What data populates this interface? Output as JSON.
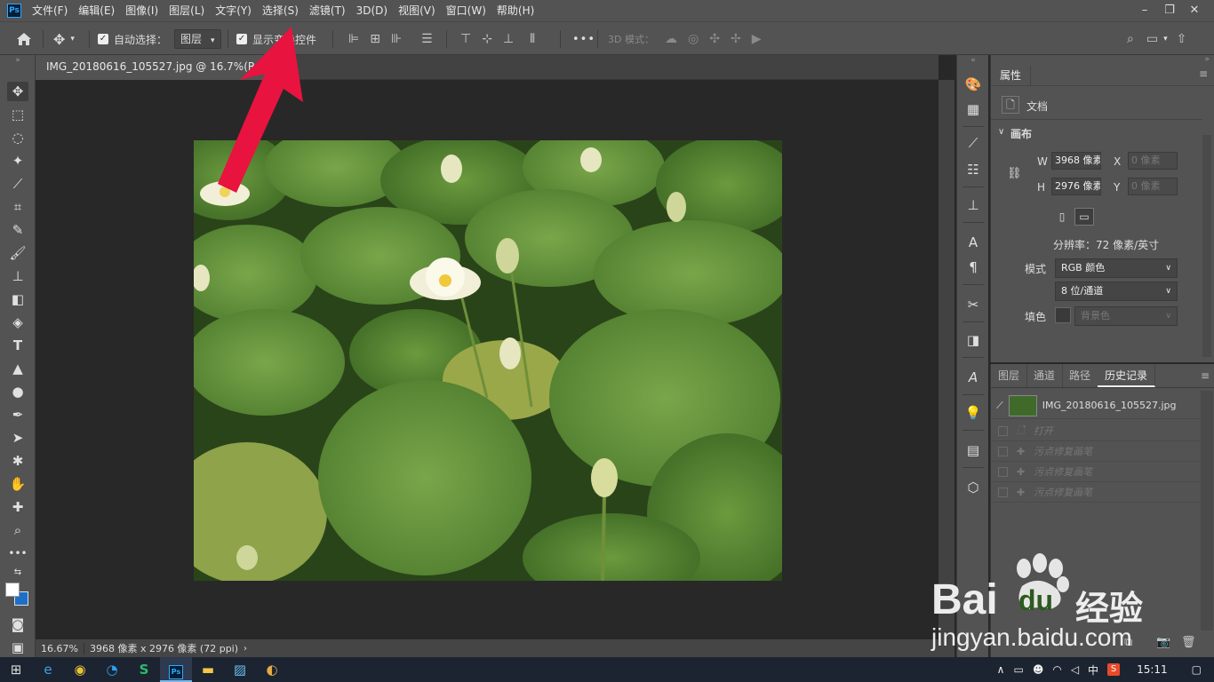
{
  "menubar": {
    "app_icon": "Ps",
    "items": [
      "文件(F)",
      "编辑(E)",
      "图像(I)",
      "图层(L)",
      "文字(Y)",
      "选择(S)",
      "滤镜(T)",
      "3D(D)",
      "视图(V)",
      "窗口(W)",
      "帮助(H)"
    ],
    "window_controls": [
      "–",
      "❐",
      "✕"
    ]
  },
  "options_bar": {
    "auto_select_label": "自动选择：",
    "auto_select_checked": true,
    "layer_dropdown": "图层",
    "show_transform_label": "显示变换控件",
    "more_icon": "•••",
    "mode_3d_label": "3D 模式："
  },
  "document": {
    "tab_title": "IMG_20180616_105527.jpg @ 16.7%(RGB/8)",
    "zoom": "16.67%",
    "status_info": "3968 像素 x 2976 像素 (72 ppi)"
  },
  "properties_panel": {
    "tab_label": "属性",
    "doc_label": "文档",
    "section_title": "画布",
    "w_label": "W",
    "w_value": "3968 像素",
    "x_label": "X",
    "x_value": "0 像素",
    "h_label": "H",
    "h_value": "2976 像素",
    "y_label": "Y",
    "y_value": "0 像素",
    "resolution_text": "分辨率：72 像素/英寸",
    "mode_label": "模式",
    "mode_value": "RGB 颜色",
    "depth_value": "8 位/通道",
    "fill_label": "填色",
    "fill_value": "背景色"
  },
  "history_panel": {
    "tabs": [
      "图层",
      "通道",
      "路径",
      "历史记录"
    ],
    "active_tab": "历史记录",
    "snapshot_name": "IMG_20180616_105527.jpg",
    "entries": [
      "打开",
      "污点修复画笔",
      "污点修复画笔",
      "污点修复画笔"
    ]
  },
  "taskbar": {
    "ime_label": "中",
    "time": "15:11"
  },
  "watermark": {
    "brand": "Bai",
    "brand_du": "du",
    "brand_cn": "经验",
    "url": "jingyan.baidu.com"
  },
  "colors": {
    "accent_arrow": "#e8133f",
    "panel_bg": "#535353",
    "canvas_bg": "#282828",
    "brand_blue": "#31a8ff"
  }
}
